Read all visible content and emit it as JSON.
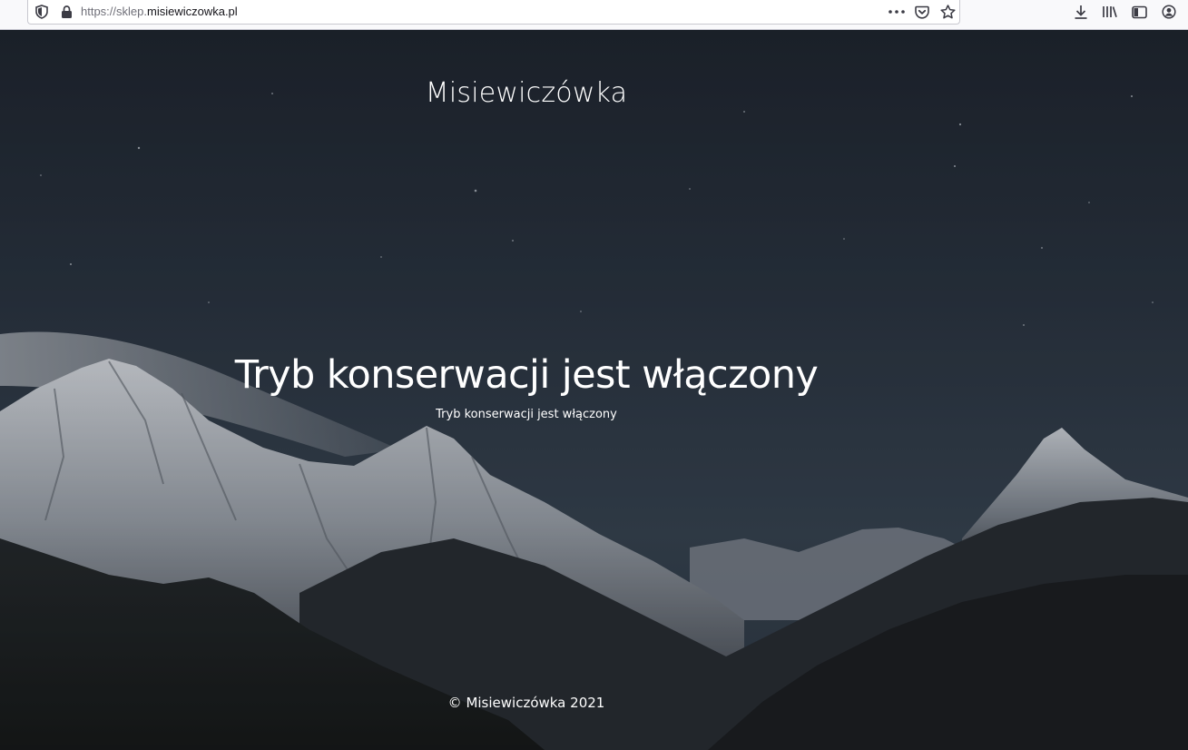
{
  "browser": {
    "url_protocol": "https://sklep.",
    "url_domain": "misiewiczowka.pl",
    "icons": {
      "tracking_shield": "shield-icon",
      "lock": "lock-icon",
      "page_actions": "more-icon",
      "pocket": "pocket-icon",
      "bookmark": "star-icon",
      "downloads": "download-icon",
      "library": "library-icon",
      "sidebar": "sidebar-icon",
      "account": "account-icon"
    }
  },
  "page": {
    "site_title": "Misiewiczówka",
    "headline": "Tryb konserwacji jest włączony",
    "subline": "Tryb konserwacji jest włączony",
    "footer": "© Misiewiczówka 2021"
  },
  "colors": {
    "text": "#ffffff",
    "sky_top": "#1c232c",
    "sky_mid": "#2f3b49"
  }
}
